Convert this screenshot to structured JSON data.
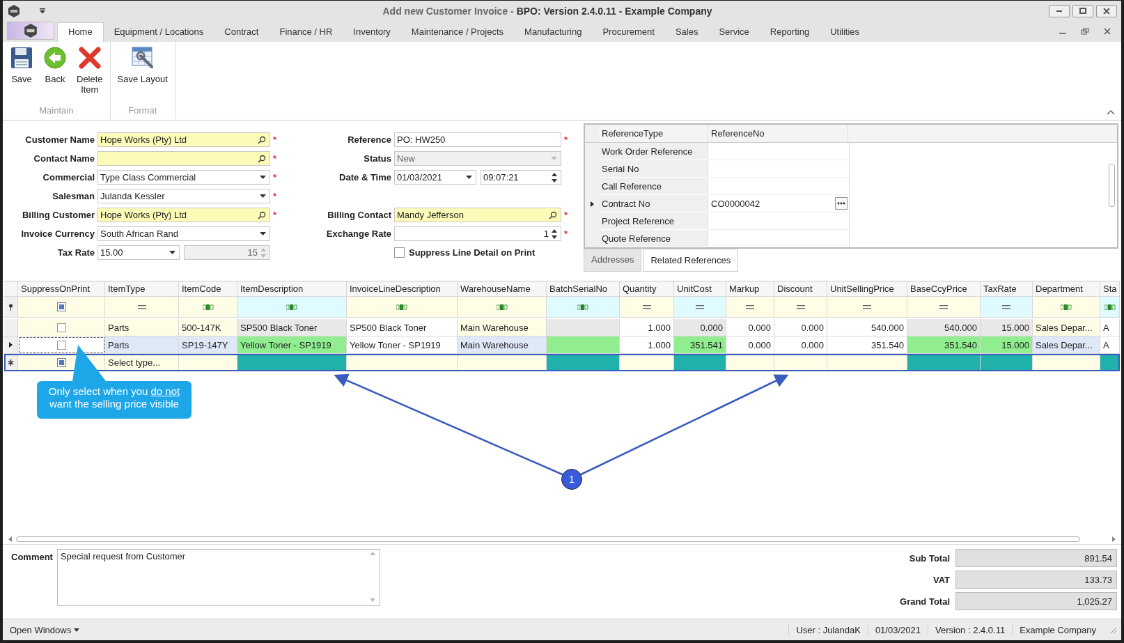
{
  "window": {
    "title": "Add new Customer Invoice - **BPO: Version 2.4.0.11 - Example Company**"
  },
  "menu_tabs": [
    {
      "label": "Home",
      "selected": true
    },
    {
      "label": "Equipment / Locations",
      "selected": false
    },
    {
      "label": "Contract",
      "selected": false
    },
    {
      "label": "Finance / HR",
      "selected": false
    },
    {
      "label": "Inventory",
      "selected": false
    },
    {
      "label": "Maintenance / Projects",
      "selected": false
    },
    {
      "label": "Manufacturing",
      "selected": false
    },
    {
      "label": "Procurement",
      "selected": false
    },
    {
      "label": "Sales",
      "selected": false
    },
    {
      "label": "Service",
      "selected": false
    },
    {
      "label": "Reporting",
      "selected": false
    },
    {
      "label": "Utilities",
      "selected": false
    }
  ],
  "ribbon_groups": [
    {
      "label": "Maintain",
      "buttons": [
        {
          "kind": "save",
          "label": "Save"
        },
        {
          "kind": "back",
          "label": "Back"
        },
        {
          "kind": "delete",
          "label": "Delete\nItem"
        }
      ]
    },
    {
      "label": "Format",
      "buttons": [
        {
          "kind": "layout",
          "label": "Save Layout"
        }
      ]
    }
  ],
  "form_rows": [
    {
      "left": {
        "label": "Customer Name",
        "required_mark": "*",
        "controls": [
          {
            "kind": "lookup",
            "value": "Hope Works (Pty) Ltd",
            "highlight": true
          }
        ]
      },
      "right": {
        "label": "Reference",
        "required_mark": "*",
        "controls": [
          {
            "kind": "text",
            "value": "PO: HW250",
            "highlight": false
          }
        ]
      }
    },
    {
      "left": {
        "label": "Contact Name",
        "required_mark": "*",
        "controls": [
          {
            "kind": "lookup",
            "highlight": true
          }
        ]
      },
      "right": {
        "label": "Status",
        "controls": [
          {
            "kind": "dropdown",
            "value": "New",
            "disabled": true
          }
        ]
      }
    },
    {
      "left": {
        "label": "Commercial",
        "required_mark": "*",
        "controls": [
          {
            "kind": "dropdown",
            "value": "Type Class Commercial"
          }
        ]
      },
      "right": {
        "label": "Date & Time",
        "controls": [
          {
            "kind": "dropdown",
            "value": "01/03/2021"
          },
          {
            "kind": "spinner",
            "value": "09:07:21"
          }
        ]
      }
    },
    {
      "left": {
        "label": "Salesman",
        "required_mark": "*",
        "controls": [
          {
            "kind": "dropdown",
            "value": "Julanda Kessler"
          }
        ]
      }
    },
    {
      "left": {
        "label": "Billing Customer",
        "required_mark": "*",
        "controls": [
          {
            "kind": "lookup",
            "value": "Hope Works (Pty) Ltd",
            "highlight": true
          }
        ]
      },
      "right": {
        "label": "Billing Contact",
        "required_mark": "*",
        "controls": [
          {
            "kind": "lookup",
            "value": "Mandy Jefferson",
            "highlight": true
          }
        ]
      }
    },
    {
      "left": {
        "label": "Invoice Currency",
        "controls": [
          {
            "kind": "dropdown",
            "value": "South African Rand"
          }
        ]
      },
      "right": {
        "label": "Exchange Rate",
        "required_mark": "*",
        "controls": [
          {
            "kind": "spinner",
            "value": "1",
            "numeric": true
          }
        ]
      }
    },
    {
      "left": {
        "label": "Tax Rate",
        "controls": [
          {
            "kind": "dropdown",
            "value": "15.00"
          },
          {
            "kind": "spinner",
            "value": "15",
            "numeric": true,
            "disabled": true
          }
        ]
      },
      "right": {
        "kind": "checkbox",
        "label": "Suppress Line Detail on Print",
        "checked": false
      }
    }
  ],
  "references": {
    "columns": [
      "ReferenceType",
      "ReferenceNo"
    ],
    "rows": [
      {
        "type": "Work Order Reference",
        "current": false
      },
      {
        "type": "Serial No",
        "current": false
      },
      {
        "type": "Call Reference",
        "current": false
      },
      {
        "type": "Contract No",
        "no": "CO0000042",
        "current": true
      },
      {
        "type": "Project Reference",
        "current": false
      },
      {
        "type": "Quote Reference",
        "current": false
      }
    ],
    "tabs": [
      {
        "label": "Addresses",
        "selected": false
      },
      {
        "label": "Related References",
        "selected": true
      }
    ]
  },
  "grid": {
    "columns": [
      {
        "label": "SuppressOnPrint",
        "kind": "check",
        "color": "#fffde6"
      },
      {
        "label": "ItemType",
        "kind": "equals",
        "color": "#fffde6"
      },
      {
        "label": "ItemCode",
        "kind": "text",
        "color": "#fffde6"
      },
      {
        "label": "ItemDescription",
        "kind": "text",
        "color": "#e0fbff"
      },
      {
        "label": "InvoiceLineDescription",
        "kind": "text",
        "color": "#fffde6"
      },
      {
        "label": "WarehouseName",
        "kind": "text",
        "color": "#fffde6"
      },
      {
        "label": "BatchSerialNo",
        "kind": "text",
        "color": "#e0fbff"
      },
      {
        "label": "Quantity",
        "kind": "number",
        "color": "#fffde6"
      },
      {
        "label": "UnitCost",
        "kind": "number",
        "color": "#e0fbff"
      },
      {
        "label": "Markup",
        "kind": "number",
        "color": "#fffde6"
      },
      {
        "label": "Discount",
        "kind": "number",
        "color": "#fffde6"
      },
      {
        "label": "UnitSellingPrice",
        "kind": "number",
        "color": "#fffde6"
      },
      {
        "label": "BaseCcyPrice",
        "kind": "number",
        "color": "#fffde6"
      },
      {
        "label": "TaxRate",
        "kind": "number",
        "color": "#e0fbff"
      },
      {
        "label": "Department",
        "kind": "text",
        "color": "#fffde6"
      },
      {
        "label": "Sta",
        "kind": "text",
        "color": "#e0fbff"
      }
    ],
    "rows": [
      {
        "kind": "data",
        "current": false,
        "checked": false,
        "indeterminate": false,
        "cells": [
          {
            "color": "#fffde6"
          },
          {
            "text": "Parts",
            "color": "#fffde6"
          },
          {
            "text": "500-147K",
            "color": "#fffde6"
          },
          {
            "text": "SP500 Black Toner",
            "color": "#e8e8e8"
          },
          {
            "text": "SP500 Black Toner",
            "color": "#ffffff"
          },
          {
            "text": "Main Warehouse",
            "color": "#fffde6"
          },
          {
            "color": "#e8e8e8"
          },
          {
            "text": "1.000",
            "color": "#ffffff"
          },
          {
            "text": "0.000",
            "color": "#e8e8e8"
          },
          {
            "text": "0.000",
            "color": "#ffffff"
          },
          {
            "text": "0.000",
            "color": "#ffffff"
          },
          {
            "text": "540.000",
            "color": "#ffffff"
          },
          {
            "text": "540.000",
            "color": "#e8e8e8"
          },
          {
            "text": "15.000",
            "color": "#e8e8e8"
          },
          {
            "text": "Sales Depar...",
            "color": "#fffde6"
          },
          {
            "text": "A",
            "color": "#ffffff"
          }
        ]
      },
      {
        "kind": "data",
        "current": true,
        "checked": false,
        "indeterminate": false,
        "cells": [
          {
            "color": "#ffffff"
          },
          {
            "text": "Parts",
            "color": "#dfe8f7"
          },
          {
            "text": "SP19-147Y",
            "color": "#dfe8f7"
          },
          {
            "text": "Yellow Toner - SP1919",
            "color": "#90ee90"
          },
          {
            "text": "Yellow Toner - SP1919",
            "color": "#ffffff"
          },
          {
            "text": "Main Warehouse",
            "color": "#dfe8f7"
          },
          {
            "color": "#90ee90"
          },
          {
            "text": "1.000",
            "color": "#ffffff"
          },
          {
            "text": "351.541",
            "color": "#90ee90"
          },
          {
            "text": "0.000",
            "color": "#ffffff"
          },
          {
            "text": "0.000",
            "color": "#ffffff"
          },
          {
            "text": "351.540",
            "color": "#ffffff"
          },
          {
            "text": "351.540",
            "color": "#90ee90"
          },
          {
            "text": "15.000",
            "color": "#90ee90"
          },
          {
            "text": "Sales Depar...",
            "color": "#dfe8f7"
          },
          {
            "text": "A",
            "color": "#ffffff"
          }
        ]
      },
      {
        "kind": "new",
        "current": false,
        "checked": false,
        "indeterminate": true,
        "cells": [
          {
            "color": "#fffde6"
          },
          {
            "text": "Select type...",
            "color": "#fffde6"
          },
          {
            "color": "#fffde6"
          },
          {
            "color": "#20b2aa"
          },
          {
            "color": "#fffde6"
          },
          {
            "color": "#fffde6"
          },
          {
            "color": "#20b2aa"
          },
          {
            "color": "#fffde6"
          },
          {
            "color": "#20b2aa"
          },
          {
            "color": "#fffde6"
          },
          {
            "color": "#fffde6"
          },
          {
            "color": "#fffde6"
          },
          {
            "color": "#20b2aa"
          },
          {
            "color": "#20b2aa"
          },
          {
            "color": "#fffde6"
          },
          {
            "color": "#20b2aa"
          }
        ]
      }
    ]
  },
  "callout": {
    "before": "Only select when you ",
    "underlined": "do not",
    "after": " want the selling price visible"
  },
  "marker": {
    "label": "1"
  },
  "comment": {
    "label": "Comment",
    "value": "Special request from Customer"
  },
  "totals": [
    {
      "label": "Sub Total",
      "value": "891.54"
    },
    {
      "label": "VAT",
      "value": "133.73"
    },
    {
      "label": "Grand Total",
      "value": "1,025.27"
    }
  ],
  "status_bar": {
    "menu": "Open Windows",
    "items": [
      "User : JulandaK",
      "01/03/2021",
      "Version : 2.4.0.11",
      "Example Company"
    ]
  }
}
